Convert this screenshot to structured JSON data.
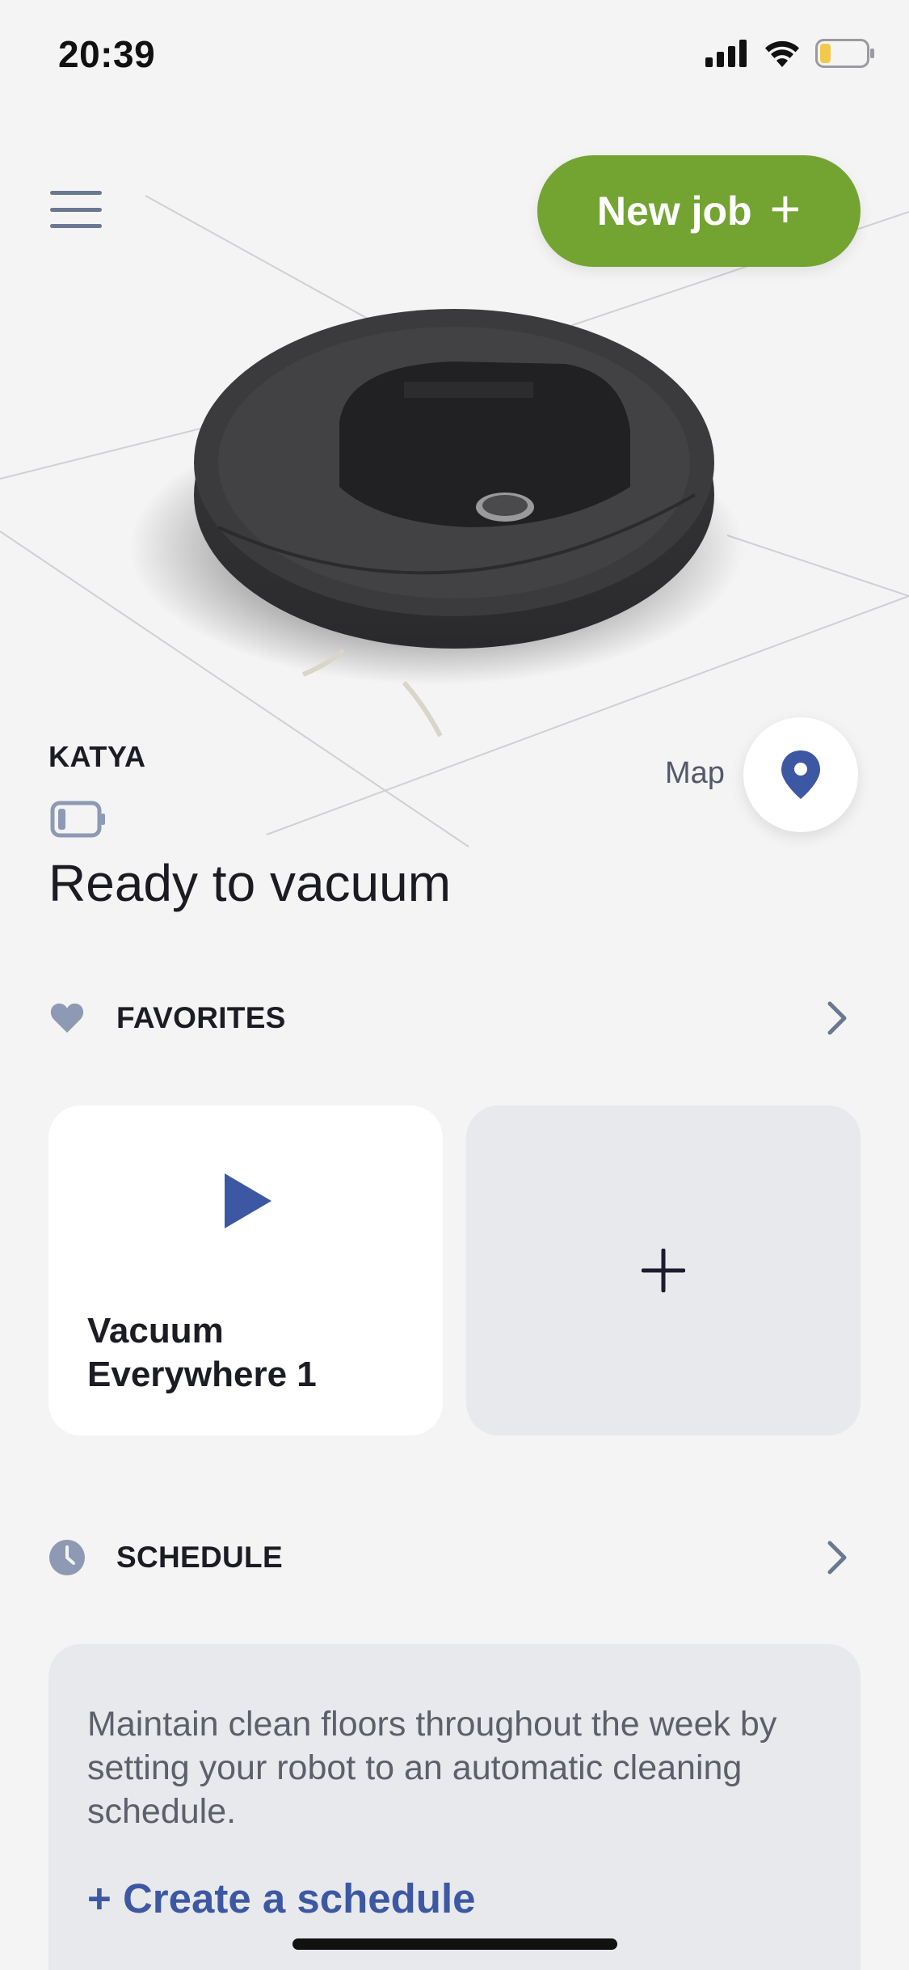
{
  "status_bar": {
    "time": "20:39",
    "icons": [
      "signal-icon",
      "wifi-icon",
      "battery-icon"
    ],
    "battery_color": "#f2c94c"
  },
  "header": {
    "menu_icon": "hamburger-menu-icon",
    "new_job_label": "New job",
    "new_job_icon": "+",
    "new_job_color": "#73a432"
  },
  "robot": {
    "name": "KATYA",
    "status": "Ready to vacuum",
    "map_label": "Map",
    "map_icon": "location-pin-icon",
    "battery_icon": "battery-low-icon"
  },
  "favorites": {
    "label": "FAVORITES",
    "icon": "heart-icon",
    "cards": [
      {
        "label": "Vacuum Everywhere 1",
        "icon": "play-icon"
      },
      {
        "label": "",
        "icon": "+"
      }
    ]
  },
  "schedule": {
    "label": "SCHEDULE",
    "icon": "clock-icon",
    "description": "Maintain clean floors throughout the week by setting your robot to an automatic cleaning schedule.",
    "create_link": "+ Create a schedule"
  },
  "colors": {
    "accent_blue": "#3d58a3",
    "icon_gray": "#8e9ab3",
    "background": "#f4f4f5"
  }
}
